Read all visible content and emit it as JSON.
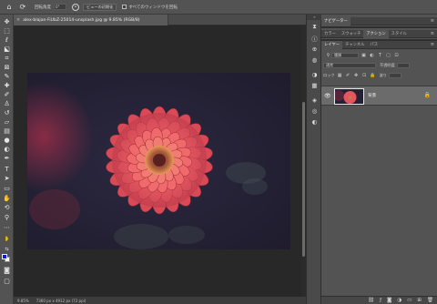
{
  "options_bar": {
    "angle_label": "回転角度",
    "angle_value": "0°",
    "reset_view_label": "ビューの初期化",
    "rotate_all_label": "すべてのウィンドウを回転"
  },
  "document": {
    "tab_title": "alex-blajan-FiUbZ-25014-unsplash.jpg @ 9.85% (RGB/8)",
    "zoom": "9.85%",
    "doc_info": "7360 px x 4912 px (72 ppi)"
  },
  "panels": {
    "navigator_tabs": [
      "ナビゲーター"
    ],
    "color_tabs": [
      "カラー",
      "スウォッチ",
      "アクション",
      "スタイル"
    ],
    "layers_tabs": [
      "レイヤー",
      "チャンネル",
      "パス"
    ],
    "filter_label": "種類",
    "blend_mode": "通常",
    "opacity_label": "不透明度",
    "lock_label": "ロック",
    "fill_label": "塗り",
    "layer_name": "背景"
  },
  "colors": {
    "foreground": "#1515e6",
    "background": "#ffffff",
    "flower_primary": "#e4555e",
    "photo_background": "#262238"
  },
  "icons": {
    "toolbar": [
      "move-icon",
      "marquee-icon",
      "lasso-icon",
      "object-select-icon",
      "crop-icon",
      "frame-icon",
      "eyedropper-icon",
      "healing-icon",
      "brush-icon",
      "stamp-icon",
      "history-brush-icon",
      "eraser-icon",
      "gradient-icon",
      "blur-icon",
      "dodge-icon",
      "pen-icon",
      "type-icon",
      "path-select-icon",
      "rectangle-icon",
      "hand-icon",
      "rotate-view-icon",
      "zoom-icon",
      "edit-toolbar-icon"
    ],
    "side_column": [
      "history-icon",
      "info-icon",
      "navigator-icon",
      "color-icon",
      "adjustments-icon",
      "libraries-icon",
      "layers-icon"
    ]
  }
}
